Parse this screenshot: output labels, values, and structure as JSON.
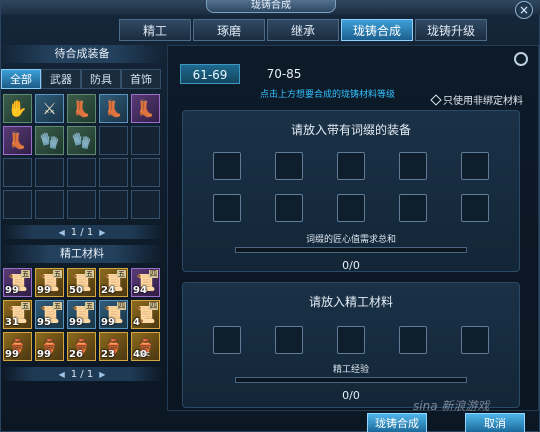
{
  "window": {
    "title": "珑铸合成",
    "close_glyph": "×"
  },
  "top_tabs": [
    {
      "label": "精工",
      "active": false
    },
    {
      "label": "琢磨",
      "active": false
    },
    {
      "label": "继承",
      "active": false
    },
    {
      "label": "珑铸合成",
      "active": true
    },
    {
      "label": "珑铸升级",
      "active": false
    }
  ],
  "left": {
    "equip_title": "待合成装备",
    "categories": [
      {
        "label": "全部",
        "active": true
      },
      {
        "label": "武器",
        "active": false
      },
      {
        "label": "防具",
        "active": false
      },
      {
        "label": "首饰",
        "active": false
      }
    ],
    "equip_pager": {
      "text": "1 / 1",
      "prev": "◀",
      "next": "▶"
    },
    "materials_title": "精工材料",
    "materials": [
      {
        "qty": "99",
        "tag": "五",
        "color": "purple",
        "icon": "scroll-icon"
      },
      {
        "qty": "99",
        "tag": "五",
        "color": "gold",
        "icon": "scroll-icon"
      },
      {
        "qty": "50",
        "tag": "五",
        "color": "gold",
        "icon": "scroll-icon"
      },
      {
        "qty": "24",
        "tag": "五",
        "color": "gold",
        "icon": "scroll-icon"
      },
      {
        "qty": "94",
        "tag": "四",
        "color": "purple",
        "icon": "scroll-icon"
      },
      {
        "qty": "31",
        "tag": "五",
        "color": "gold",
        "icon": "scroll-icon"
      },
      {
        "qty": "95",
        "tag": "五",
        "color": "blue",
        "icon": "scroll-icon"
      },
      {
        "qty": "99",
        "tag": "五",
        "color": "blue",
        "icon": "scroll-icon"
      },
      {
        "qty": "99",
        "tag": "四",
        "color": "blue",
        "icon": "scroll-icon"
      },
      {
        "qty": "4",
        "tag": "四",
        "color": "gold",
        "icon": "scroll-icon"
      },
      {
        "qty": "99",
        "tag": "",
        "color": "gold",
        "icon": "gourd-icon"
      },
      {
        "qty": "99",
        "tag": "",
        "color": "gold",
        "icon": "gourd-icon"
      },
      {
        "qty": "26",
        "tag": "",
        "color": "gold",
        "icon": "gourd-icon"
      },
      {
        "qty": "23",
        "tag": "",
        "color": "gold",
        "icon": "gourd-icon"
      },
      {
        "qty": "40",
        "tag": "",
        "color": "gold",
        "icon": "gourd-icon"
      }
    ],
    "materials_pager": {
      "text": "1 / 1",
      "prev": "◀",
      "next": "▶"
    },
    "equip_items": [
      {
        "icon": "gauntlet-icon",
        "color": "filled"
      },
      {
        "icon": "sword-icon",
        "color": "blue"
      },
      {
        "icon": "boot-icon",
        "color": "filled"
      },
      {
        "icon": "boot-icon",
        "color": "blue"
      },
      {
        "icon": "boot-icon",
        "color": "purple"
      },
      {
        "icon": "boot-icon",
        "color": "purple"
      },
      {
        "icon": "glove-icon",
        "color": "filled"
      },
      {
        "icon": "glove-icon",
        "color": "filled"
      }
    ]
  },
  "right": {
    "levels": [
      {
        "label": "61-69",
        "active": true
      },
      {
        "label": "70-85",
        "active": false
      }
    ],
    "hint": "点击上方想要合成的珑铸材料等级",
    "unbound_label": "只使用非绑定材料",
    "equip_box": {
      "title": "请放入带有词缀的装备",
      "bar_label": "词缀的匠心值需求总和",
      "bar_value": "0/0",
      "bar_fraction": 0
    },
    "material_box": {
      "title": "请放入精工材料",
      "bar_label": "精工经验",
      "bar_value": "0/0",
      "bar_fraction": 0
    }
  },
  "buttons": {
    "craft": "珑铸合成",
    "cancel": "取消"
  },
  "watermark": "sina 新浪游戏"
}
